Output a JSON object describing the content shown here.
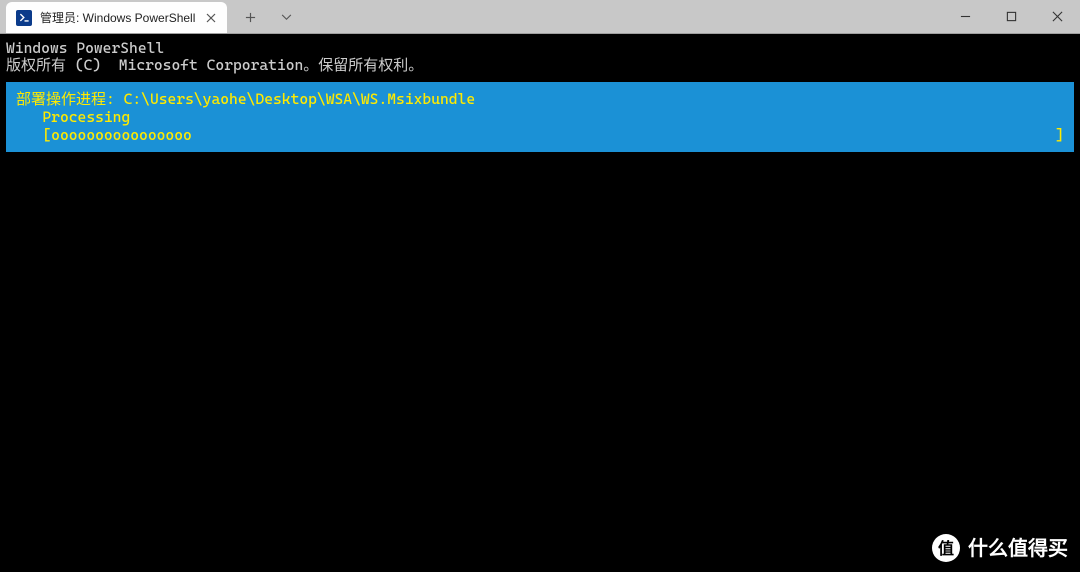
{
  "tab": {
    "title": "管理员: Windows PowerShell"
  },
  "terminal": {
    "line1": "Windows PowerShell",
    "line2": "版权所有 (C)  Microsoft Corporation。保留所有权利。"
  },
  "progress": {
    "title": "部署操作进程: C:\\Users\\yaohe\\Desktop\\WSA\\WS.Msixbundle",
    "status": "   Processing",
    "bar_left": "   [oooooooooooooooo",
    "bar_right": "]"
  },
  "watermark": {
    "badge": "值",
    "text": "什么值得买"
  }
}
